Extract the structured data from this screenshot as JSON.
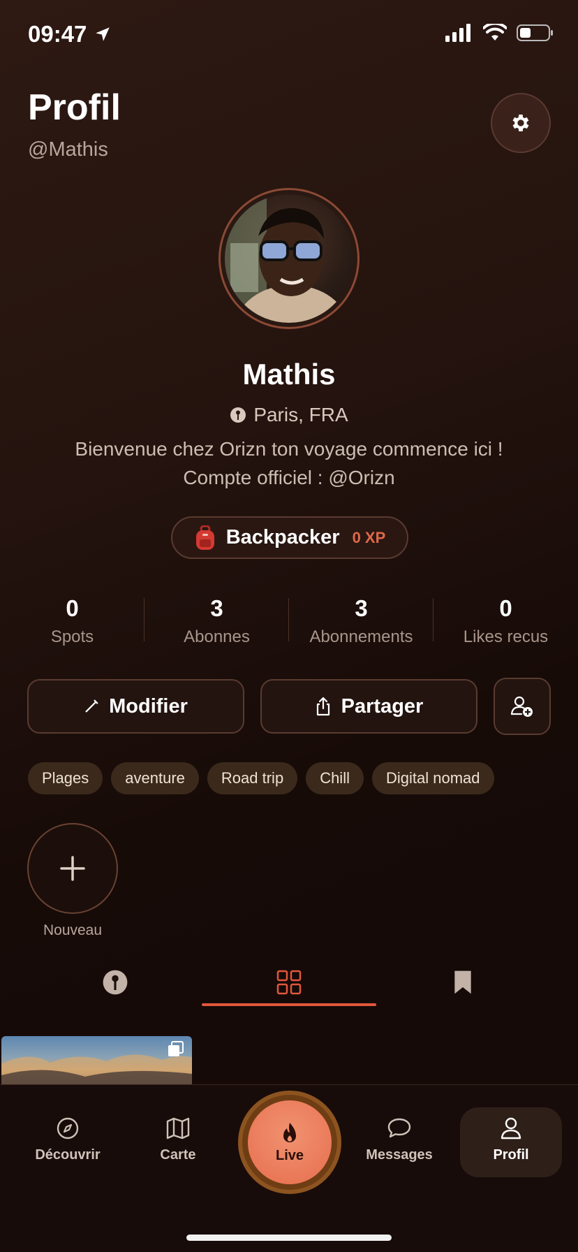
{
  "status_bar": {
    "time": "09:47"
  },
  "header": {
    "title": "Profil",
    "handle": "@Mathis"
  },
  "profile": {
    "name": "Mathis",
    "location": "Paris, FRA",
    "bio": "Bienvenue chez Orizn ton voyage commence ici !  Compte officiel : @Orizn",
    "badge": {
      "label": "Backpacker",
      "xp": "0 XP",
      "icon": "backpack-icon"
    }
  },
  "stats": [
    {
      "value": "0",
      "label": "Spots"
    },
    {
      "value": "3",
      "label": "Abonnes"
    },
    {
      "value": "3",
      "label": "Abonnements"
    },
    {
      "value": "0",
      "label": "Likes recus"
    }
  ],
  "actions": {
    "edit_label": "Modifier",
    "share_label": "Partager"
  },
  "tags": [
    "Plages",
    "aventure",
    "Road trip",
    "Chill",
    "Digital nomad"
  ],
  "highlights": {
    "new_label": "Nouveau"
  },
  "content_tabs": {
    "active": "grid",
    "items": [
      "pin-icon",
      "grid-icon",
      "bookmark-icon"
    ]
  },
  "bottom_nav": [
    {
      "label": "Découvrir",
      "icon": "compass-icon"
    },
    {
      "label": "Carte",
      "icon": "map-icon"
    },
    {
      "label": "Live",
      "icon": "flame-icon"
    },
    {
      "label": "Messages",
      "icon": "chat-icon"
    },
    {
      "label": "Profil",
      "icon": "user-icon",
      "active": true
    }
  ],
  "colors": {
    "accent": "#e0573c",
    "live": "#ec7b5a",
    "background": "#1f100c"
  }
}
